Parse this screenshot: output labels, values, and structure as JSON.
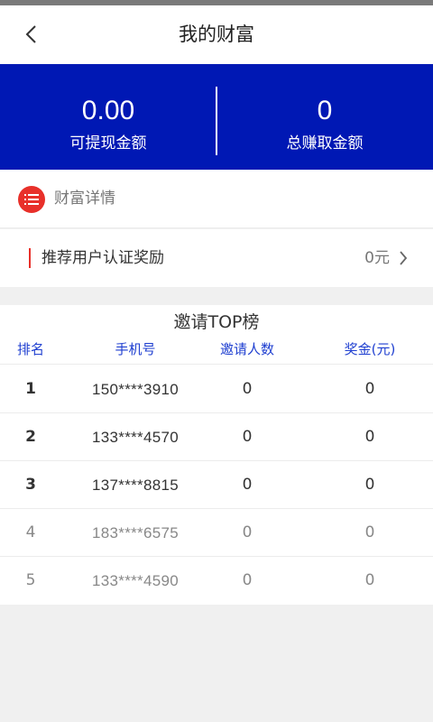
{
  "header": {
    "title": "我的财富"
  },
  "summary": {
    "withdrawable_value": "0.00",
    "withdrawable_label": "可提现金额",
    "total_value": "0",
    "total_label": "总赚取金额",
    "bg_color": "#0018b4"
  },
  "wealth_detail": {
    "label": "财富详情",
    "icon": "list-icon",
    "icon_color": "#e8302a"
  },
  "reward": {
    "label": "推荐用户认证奖励",
    "value": "0元",
    "icon": "chevron-right-icon"
  },
  "ranking": {
    "title": "邀请TOP榜",
    "columns": [
      "排名",
      "手机号",
      "邀请人数",
      "奖金(元)"
    ],
    "rows": [
      {
        "rank": "1",
        "phone": "150****3910",
        "invites": "0",
        "bonus": "0"
      },
      {
        "rank": "2",
        "phone": "133****4570",
        "invites": "0",
        "bonus": "0"
      },
      {
        "rank": "3",
        "phone": "137****8815",
        "invites": "0",
        "bonus": "0"
      },
      {
        "rank": "4",
        "phone": "183****6575",
        "invites": "0",
        "bonus": "0"
      },
      {
        "rank": "5",
        "phone": "133****4590",
        "invites": "0",
        "bonus": "0"
      }
    ]
  }
}
